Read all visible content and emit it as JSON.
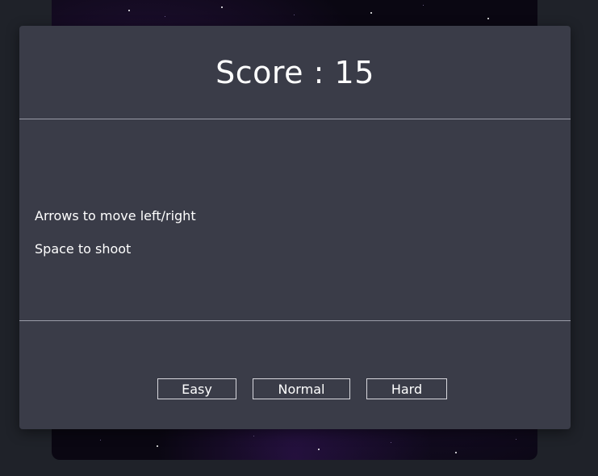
{
  "game": {
    "score_label": "Score : 15",
    "score": 15
  },
  "instructions": {
    "move": "Arrows to move left/right",
    "shoot": "Space to shoot"
  },
  "difficulty": {
    "easy": "Easy",
    "normal": "Normal",
    "hard": "Hard"
  },
  "colors": {
    "modal_bg": "#3a3c48",
    "page_bg": "#1f2229",
    "text": "#ffffff"
  }
}
